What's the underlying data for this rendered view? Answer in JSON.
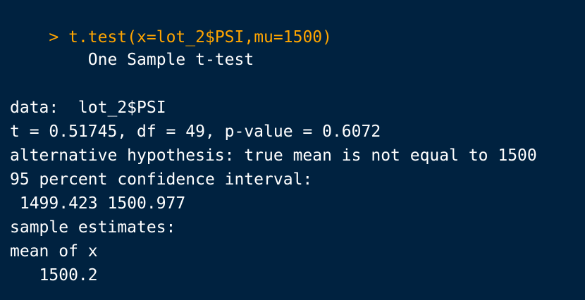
{
  "console": {
    "prompt_symbol": ">",
    "command": "t.test(x=lot_2$PSI,mu=1500)",
    "output": {
      "title": "        One Sample t-test",
      "data_line": "data:  lot_2$PSI",
      "stats_line": "t = 0.51745, df = 49, p-value = 0.6072",
      "alt_hypothesis": "alternative hypothesis: true mean is not equal to 1500",
      "ci_header": "95 percent confidence interval:",
      "ci_values": " 1499.423 1500.977",
      "estimates_header": "sample estimates:",
      "estimates_label": "mean of x",
      "estimates_value": "   1500.2"
    }
  },
  "colors": {
    "background": "#002240",
    "command": "#ffa500",
    "output": "#ffffff"
  }
}
